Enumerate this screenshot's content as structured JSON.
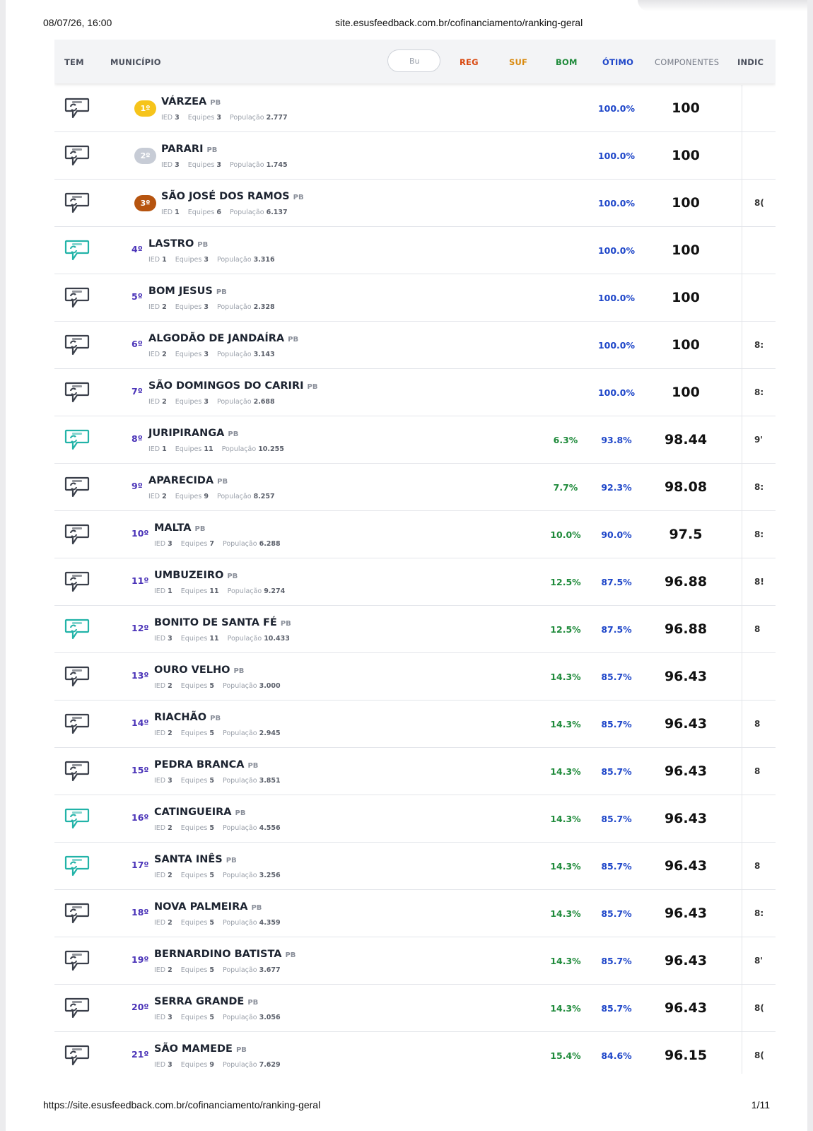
{
  "print_header": {
    "datetime": "08/07/26, 16:00",
    "url": "site.esusfeedback.com.br/cofinanciamento/ranking-geral"
  },
  "print_footer": {
    "url": "https://site.esusfeedback.com.br/cofinanciamento/ranking-geral",
    "page": "1/11"
  },
  "table": {
    "headers": {
      "tem": "TEM",
      "municipio": "MUNICÍPIO",
      "search_placeholder": "Bu",
      "reg": "REG",
      "suf": "SUF",
      "bom": "BOM",
      "otimo": "ÓTIMO",
      "componentes": "COMPONENTES",
      "indic": "INDIC"
    },
    "meta_labels": {
      "ied": "IED",
      "equipes": "Equipes",
      "populacao": "População"
    },
    "colors": {
      "feedback_active": "#22b3a8",
      "feedback_inactive": "#3a3f4a",
      "rank": "#4a33b8",
      "bom": "#1e8a3a",
      "otimo": "#1e46c9"
    },
    "rows": [
      {
        "rank": "1º",
        "medal": "gold",
        "name": "VÁRZEA",
        "uf": "PB",
        "ied": "3",
        "equipes": "3",
        "populacao": "2.777",
        "bom": "",
        "otimo": "100.0%",
        "componentes": "100",
        "indic": "",
        "active": false
      },
      {
        "rank": "2º",
        "medal": "silver",
        "name": "PARARI",
        "uf": "PB",
        "ied": "3",
        "equipes": "3",
        "populacao": "1.745",
        "bom": "",
        "otimo": "100.0%",
        "componentes": "100",
        "indic": "",
        "active": false
      },
      {
        "rank": "3º",
        "medal": "bronze",
        "name": "SÃO JOSÉ DOS RAMOS",
        "uf": "PB",
        "ied": "1",
        "equipes": "6",
        "populacao": "6.137",
        "bom": "",
        "otimo": "100.0%",
        "componentes": "100",
        "indic": "8(",
        "active": false
      },
      {
        "rank": "4º",
        "medal": "",
        "name": "LASTRO",
        "uf": "PB",
        "ied": "1",
        "equipes": "3",
        "populacao": "3.316",
        "bom": "",
        "otimo": "100.0%",
        "componentes": "100",
        "indic": "",
        "active": true
      },
      {
        "rank": "5º",
        "medal": "",
        "name": "BOM JESUS",
        "uf": "PB",
        "ied": "2",
        "equipes": "3",
        "populacao": "2.328",
        "bom": "",
        "otimo": "100.0%",
        "componentes": "100",
        "indic": "",
        "active": false
      },
      {
        "rank": "6º",
        "medal": "",
        "name": "ALGODÃO DE JANDAÍRA",
        "uf": "PB",
        "ied": "2",
        "equipes": "3",
        "populacao": "3.143",
        "bom": "",
        "otimo": "100.0%",
        "componentes": "100",
        "indic": "8:",
        "active": false
      },
      {
        "rank": "7º",
        "medal": "",
        "name": "SÃO DOMINGOS DO CARIRI",
        "uf": "PB",
        "ied": "2",
        "equipes": "3",
        "populacao": "2.688",
        "bom": "",
        "otimo": "100.0%",
        "componentes": "100",
        "indic": "8:",
        "active": false
      },
      {
        "rank": "8º",
        "medal": "",
        "name": "JURIPIRANGA",
        "uf": "PB",
        "ied": "1",
        "equipes": "11",
        "populacao": "10.255",
        "bom": "6.3%",
        "otimo": "93.8%",
        "componentes": "98.44",
        "indic": "9'",
        "active": true
      },
      {
        "rank": "9º",
        "medal": "",
        "name": "APARECIDA",
        "uf": "PB",
        "ied": "2",
        "equipes": "9",
        "populacao": "8.257",
        "bom": "7.7%",
        "otimo": "92.3%",
        "componentes": "98.08",
        "indic": "8:",
        "active": false
      },
      {
        "rank": "10º",
        "medal": "",
        "name": "MALTA",
        "uf": "PB",
        "ied": "3",
        "equipes": "7",
        "populacao": "6.288",
        "bom": "10.0%",
        "otimo": "90.0%",
        "componentes": "97.5",
        "indic": "8:",
        "active": false
      },
      {
        "rank": "11º",
        "medal": "",
        "name": "UMBUZEIRO",
        "uf": "PB",
        "ied": "1",
        "equipes": "11",
        "populacao": "9.274",
        "bom": "12.5%",
        "otimo": "87.5%",
        "componentes": "96.88",
        "indic": "8!",
        "active": false
      },
      {
        "rank": "12º",
        "medal": "",
        "name": "BONITO DE SANTA FÉ",
        "uf": "PB",
        "ied": "3",
        "equipes": "11",
        "populacao": "10.433",
        "bom": "12.5%",
        "otimo": "87.5%",
        "componentes": "96.88",
        "indic": "8",
        "active": true
      },
      {
        "rank": "13º",
        "medal": "",
        "name": "OURO VELHO",
        "uf": "PB",
        "ied": "2",
        "equipes": "5",
        "populacao": "3.000",
        "bom": "14.3%",
        "otimo": "85.7%",
        "componentes": "96.43",
        "indic": "",
        "active": false
      },
      {
        "rank": "14º",
        "medal": "",
        "name": "RIACHÃO",
        "uf": "PB",
        "ied": "2",
        "equipes": "5",
        "populacao": "2.945",
        "bom": "14.3%",
        "otimo": "85.7%",
        "componentes": "96.43",
        "indic": "8",
        "active": false
      },
      {
        "rank": "15º",
        "medal": "",
        "name": "PEDRA BRANCA",
        "uf": "PB",
        "ied": "3",
        "equipes": "5",
        "populacao": "3.851",
        "bom": "14.3%",
        "otimo": "85.7%",
        "componentes": "96.43",
        "indic": "8",
        "active": false
      },
      {
        "rank": "16º",
        "medal": "",
        "name": "CATINGUEIRA",
        "uf": "PB",
        "ied": "2",
        "equipes": "5",
        "populacao": "4.556",
        "bom": "14.3%",
        "otimo": "85.7%",
        "componentes": "96.43",
        "indic": "",
        "active": true
      },
      {
        "rank": "17º",
        "medal": "",
        "name": "SANTA INÊS",
        "uf": "PB",
        "ied": "2",
        "equipes": "5",
        "populacao": "3.256",
        "bom": "14.3%",
        "otimo": "85.7%",
        "componentes": "96.43",
        "indic": "8",
        "active": true
      },
      {
        "rank": "18º",
        "medal": "",
        "name": "NOVA PALMEIRA",
        "uf": "PB",
        "ied": "2",
        "equipes": "5",
        "populacao": "4.359",
        "bom": "14.3%",
        "otimo": "85.7%",
        "componentes": "96.43",
        "indic": "8:",
        "active": false
      },
      {
        "rank": "19º",
        "medal": "",
        "name": "BERNARDINO BATISTA",
        "uf": "PB",
        "ied": "2",
        "equipes": "5",
        "populacao": "3.677",
        "bom": "14.3%",
        "otimo": "85.7%",
        "componentes": "96.43",
        "indic": "8'",
        "active": false
      },
      {
        "rank": "20º",
        "medal": "",
        "name": "SERRA GRANDE",
        "uf": "PB",
        "ied": "3",
        "equipes": "5",
        "populacao": "3.056",
        "bom": "14.3%",
        "otimo": "85.7%",
        "componentes": "96.43",
        "indic": "8(",
        "active": false
      },
      {
        "rank": "21º",
        "medal": "",
        "name": "SÃO MAMEDE",
        "uf": "PB",
        "ied": "3",
        "equipes": "9",
        "populacao": "7.629",
        "bom": "15.4%",
        "otimo": "84.6%",
        "componentes": "96.15",
        "indic": "8(",
        "active": false
      }
    ]
  }
}
